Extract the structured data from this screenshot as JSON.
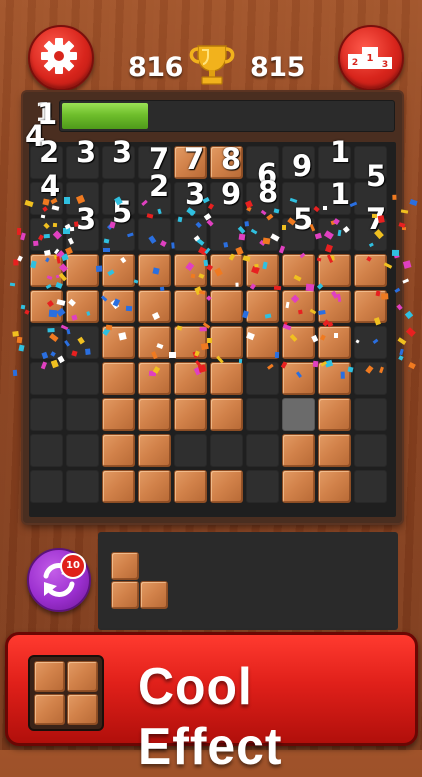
{
  "header": {
    "current_score": "816",
    "best_score": "815",
    "settings_icon": "gear-icon",
    "trophy_icon": "trophy-icon",
    "leaderboard_icon": "podium-icon"
  },
  "level": {
    "number": "1",
    "progress": 0.26
  },
  "grid": {
    "rows": 10,
    "cols": 10,
    "cells": [
      "..........",
      "....WW....",
      "..........",
      "..........",
      "WWWWWWWWWW",
      "WWWWWWWWWW",
      "..WWWWWWW.",
      "..WWWW.WW.",
      "..WWWW.HW.",
      "..WW...WW.",
      "..WWWW.WW."
    ],
    "floating_numbers": [
      "1",
      "4",
      "2",
      "3",
      "3",
      "7",
      "7",
      "8",
      "1",
      "4",
      "2",
      "6",
      "9",
      "5",
      "3",
      "9",
      "8",
      "1",
      "3",
      "5",
      "5",
      "7"
    ],
    "colors": {
      "wood": "#d2824a",
      "empty": "#2f2f2f",
      "hint": "#6b6b6b"
    }
  },
  "tray": {
    "refresh_badge": "10",
    "refresh_icon": "refresh-icon",
    "piece_shape": [
      "X.",
      "XX"
    ]
  },
  "banner": {
    "text": "Cool Effect",
    "icon": "square-piece-icon",
    "color": "#e0201a"
  }
}
